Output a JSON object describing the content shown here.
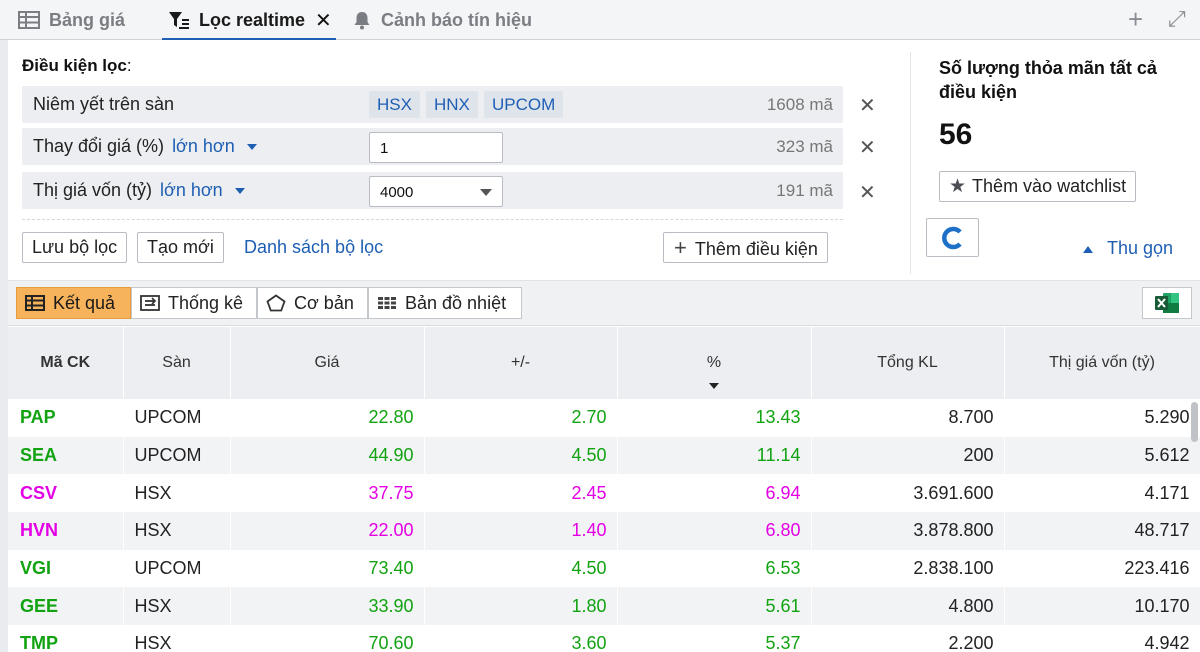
{
  "tabs": [
    {
      "label": "Bảng giá",
      "icon": "table-icon",
      "active": false
    },
    {
      "label": "Lọc realtime",
      "icon": "filter-icon",
      "active": true
    },
    {
      "label": "Cảnh báo tín hiệu",
      "icon": "bell-icon",
      "active": false
    }
  ],
  "toolbar": {
    "add": "+",
    "expand": "⤢"
  },
  "filter": {
    "title": "Điều kiện lọc",
    "title_suffix": ":",
    "conditions": [
      {
        "label": "Niêm yết trên sàn",
        "chips": [
          "HSX",
          "HNX",
          "UPCOM"
        ],
        "count": "1608 mã"
      },
      {
        "label": "Thay đổi giá (%)",
        "operator": "lớn hơn",
        "value": "1",
        "count": "323 mã"
      },
      {
        "label": "Thị giá vốn (tỷ)",
        "operator": "lớn hơn",
        "value": "4000",
        "count": "191 mã"
      }
    ],
    "save_btn": "Lưu bộ lọc",
    "new_btn": "Tạo mới",
    "list_link": "Danh sách bộ lọc",
    "add_cond_btn": "Thêm điều kiện"
  },
  "summary": {
    "title": "Số lượng thỏa mãn tất cả điều kiện",
    "count": "56",
    "watchlist_btn": "Thêm vào watchlist",
    "collapse": "Thu gọn"
  },
  "views": [
    {
      "label": "Kết quả",
      "icon": "table-icon",
      "active": true
    },
    {
      "label": "Thống kê",
      "icon": "stats-icon",
      "active": false
    },
    {
      "label": "Cơ bản",
      "icon": "pentagon-icon",
      "active": false
    },
    {
      "label": "Bản đồ nhiệt",
      "icon": "heatmap-icon",
      "active": false
    }
  ],
  "table": {
    "headers": [
      "Mã CK",
      "Sàn",
      "Giá",
      "+/-",
      "%",
      "Tổng KL",
      "Thị giá vốn (tỷ)"
    ],
    "rows": [
      {
        "sym": "PAP",
        "san": "UPCOM",
        "gia": "22.80",
        "chg": "2.70",
        "pct": "13.43",
        "kl": "8.700",
        "tgv": "5.290",
        "color": "#11a311"
      },
      {
        "sym": "SEA",
        "san": "UPCOM",
        "gia": "44.90",
        "chg": "4.50",
        "pct": "11.14",
        "kl": "200",
        "tgv": "5.612",
        "color": "#11a311"
      },
      {
        "sym": "CSV",
        "san": "HSX",
        "gia": "37.75",
        "chg": "2.45",
        "pct": "6.94",
        "kl": "3.691.600",
        "tgv": "4.171",
        "color": "#e400e4"
      },
      {
        "sym": "HVN",
        "san": "HSX",
        "gia": "22.00",
        "chg": "1.40",
        "pct": "6.80",
        "kl": "3.878.800",
        "tgv": "48.717",
        "color": "#e400e4"
      },
      {
        "sym": "VGI",
        "san": "UPCOM",
        "gia": "73.40",
        "chg": "4.50",
        "pct": "6.53",
        "kl": "2.838.100",
        "tgv": "223.416",
        "color": "#11a311"
      },
      {
        "sym": "GEE",
        "san": "HSX",
        "gia": "33.90",
        "chg": "1.80",
        "pct": "5.61",
        "kl": "4.800",
        "tgv": "10.170",
        "color": "#11a311"
      },
      {
        "sym": "TMP",
        "san": "HSX",
        "gia": "70.60",
        "chg": "3.60",
        "pct": "5.37",
        "kl": "2.200",
        "tgv": "4.942",
        "color": "#11a311"
      }
    ]
  }
}
